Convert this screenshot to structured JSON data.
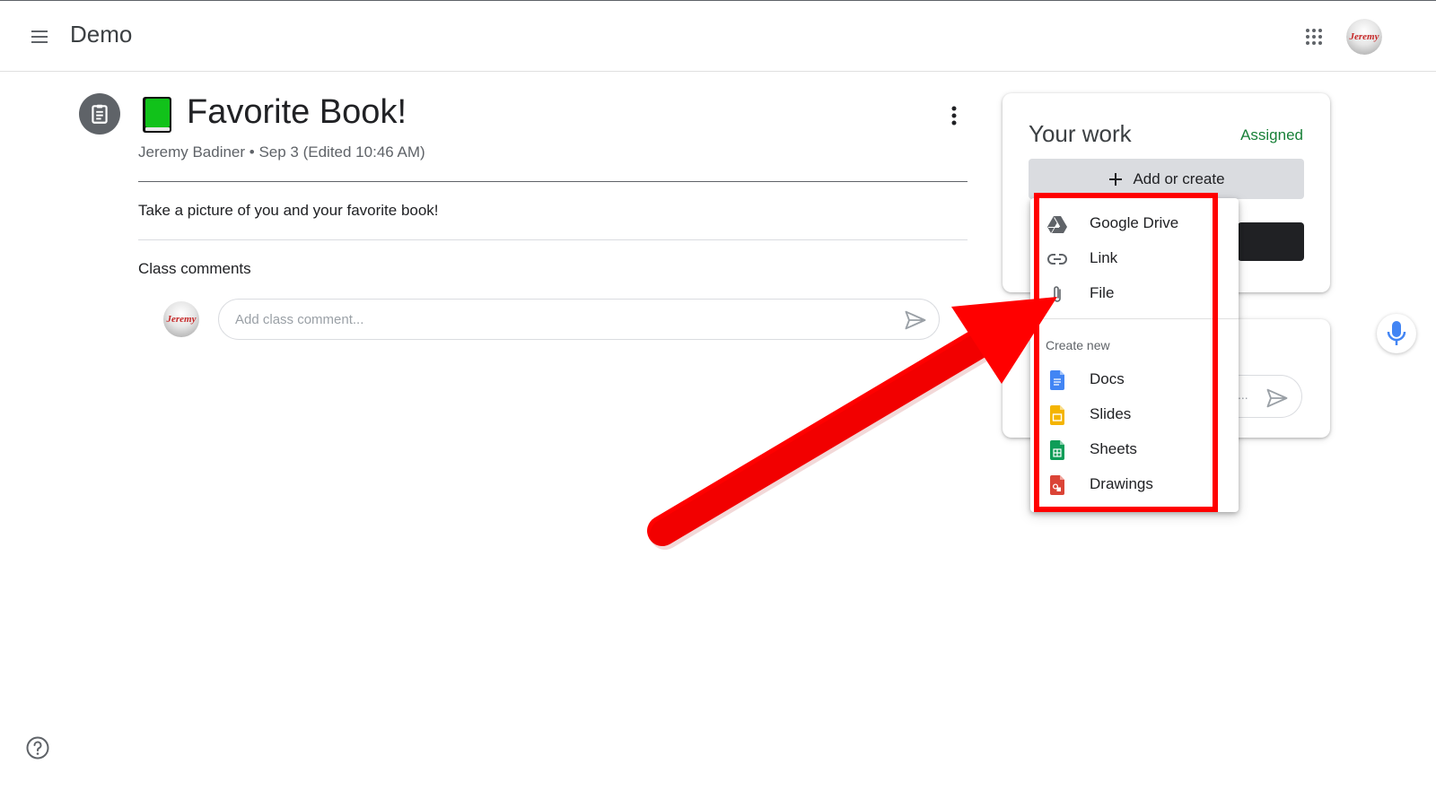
{
  "header": {
    "app_title": "Demo",
    "avatar_text": "Jeremy"
  },
  "post": {
    "title": "Favorite Book!",
    "meta": "Jeremy Badiner • Sep 3 (Edited 10:46 AM)",
    "description": "Take a picture of you and your favorite book!"
  },
  "comments": {
    "title": "Class comments",
    "placeholder": "Add class comment...",
    "avatar_text": "Jeremy"
  },
  "your_work": {
    "title": "Your work",
    "status": "Assigned",
    "add_button_label": "Add or create",
    "private_placeholder": "..."
  },
  "add_menu": {
    "items": [
      {
        "label": "Google Drive",
        "icon": "google-drive-icon"
      },
      {
        "label": "Link",
        "icon": "link-icon"
      },
      {
        "label": "File",
        "icon": "paperclip-icon"
      }
    ],
    "create_heading": "Create new",
    "create_items": [
      {
        "label": "Docs",
        "icon": "google-docs-icon",
        "color": "#4285f4"
      },
      {
        "label": "Slides",
        "icon": "google-slides-icon",
        "color": "#f4b400"
      },
      {
        "label": "Sheets",
        "icon": "google-sheets-icon",
        "color": "#0f9d58"
      },
      {
        "label": "Drawings",
        "icon": "google-drawings-icon",
        "color": "#db4437"
      }
    ]
  },
  "annotation": {
    "highlight_color": "#ff0000"
  },
  "colors": {
    "assigned_status": "#188038",
    "text_primary": "#202124",
    "text_secondary": "#5f6368"
  }
}
